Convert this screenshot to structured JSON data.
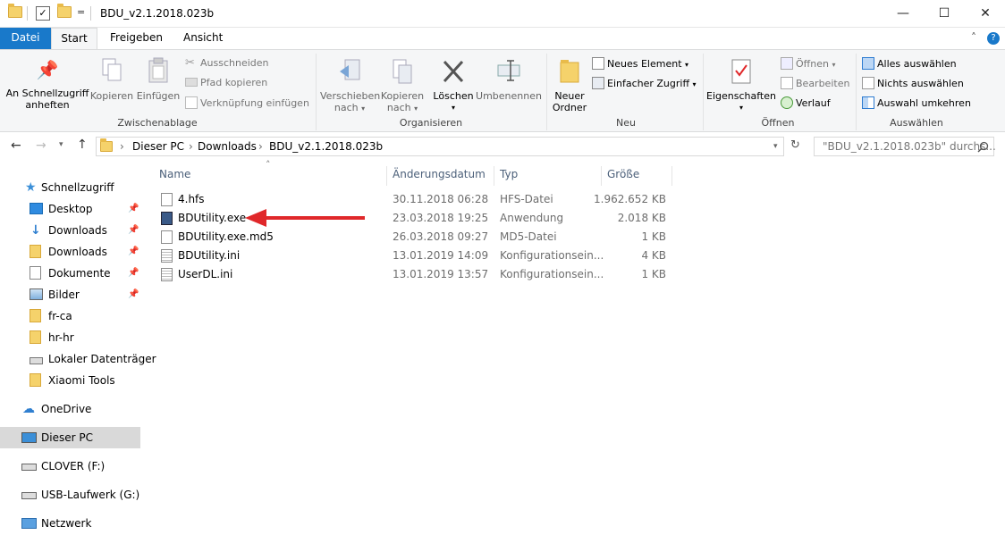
{
  "window": {
    "title": "BDU_v2.1.2018.023b",
    "minimize": "—",
    "maximize": "☐",
    "close": "✕",
    "qat_dropdown": "=",
    "help": "?"
  },
  "tabs": [
    "Datei",
    "Start",
    "Freigeben",
    "Ansicht"
  ],
  "ribbon": {
    "clipboard": {
      "pin_line1": "An Schnellzugriff",
      "pin_line2": "anheften",
      "copy": "Kopieren",
      "paste": "Einfügen",
      "cut": "Ausschneiden",
      "copy_path": "Pfad kopieren",
      "paste_shortcut": "Verknüpfung einfügen",
      "label": "Zwischenablage"
    },
    "organize": {
      "move_line1": "Verschieben",
      "move_line2": "nach",
      "copyto_line1": "Kopieren",
      "copyto_line2": "nach",
      "delete": "Löschen",
      "rename": "Umbenennen",
      "label": "Organisieren"
    },
    "new": {
      "folder_line1": "Neuer",
      "folder_line2": "Ordner",
      "new_item": "Neues Element",
      "easy_access": "Einfacher Zugriff",
      "label": "Neu"
    },
    "open": {
      "properties": "Eigenschaften",
      "open": "Öffnen",
      "edit": "Bearbeiten",
      "history": "Verlauf",
      "label": "Öffnen"
    },
    "select": {
      "select_all": "Alles auswählen",
      "select_none": "Nichts auswählen",
      "invert": "Auswahl umkehren",
      "label": "Auswählen"
    }
  },
  "address": {
    "crumbs": [
      "Dieser PC",
      "Downloads",
      "BDU_v2.1.2018.023b"
    ],
    "search_placeholder": "\"BDU_v2.1.2018.023b\" durchs..."
  },
  "sidebar": {
    "quick_access": "Schnellzugriff",
    "items": [
      "Desktop",
      "Downloads",
      "Downloads",
      "Dokumente",
      "Bilder",
      "fr-ca",
      "hr-hr",
      "Lokaler Datenträger",
      "Xiaomi Tools"
    ],
    "onedrive": "OneDrive",
    "this_pc": "Dieser PC",
    "clover": "CLOVER (F:)",
    "usb": "USB-Laufwerk (G:)",
    "network": "Netzwerk"
  },
  "columns": {
    "name": "Name",
    "date": "Änderungsdatum",
    "type": "Typ",
    "size": "Größe"
  },
  "files": [
    {
      "name": "4.hfs",
      "date": "30.11.2018 06:28",
      "type": "HFS-Datei",
      "size": "1.962.652 KB"
    },
    {
      "name": "BDUtility.exe",
      "date": "23.03.2018 19:25",
      "type": "Anwendung",
      "size": "2.018 KB"
    },
    {
      "name": "BDUtility.exe.md5",
      "date": "26.03.2018 09:27",
      "type": "MD5-Datei",
      "size": "1 KB"
    },
    {
      "name": "BDUtility.ini",
      "date": "13.01.2019 14:09",
      "type": "Konfigurationsein...",
      "size": "4 KB"
    },
    {
      "name": "UserDL.ini",
      "date": "13.01.2019 13:57",
      "type": "Konfigurationsein...",
      "size": "1 KB"
    }
  ],
  "colors": {
    "accent": "#1979ca",
    "arrow": "#e0282a",
    "ribbon_bg": "#f5f6f7"
  }
}
